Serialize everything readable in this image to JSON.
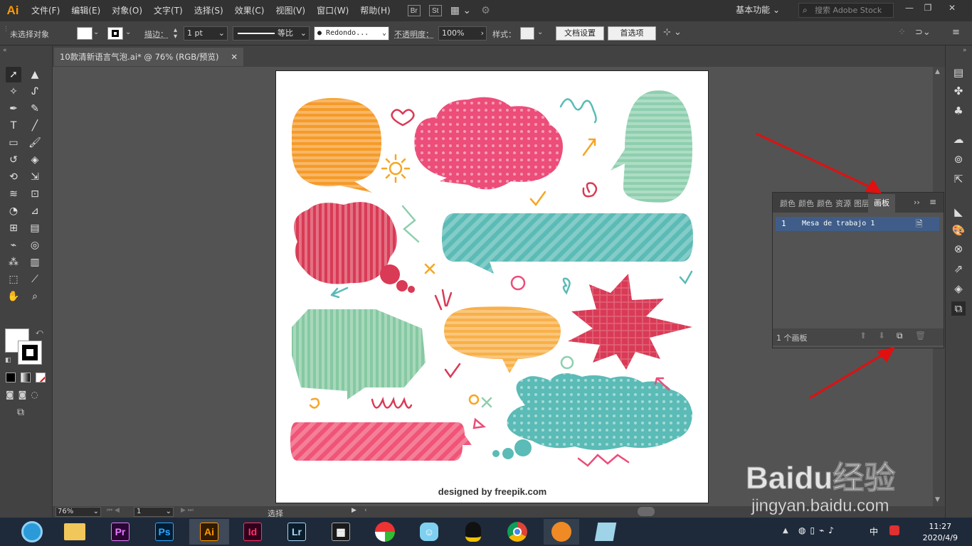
{
  "app": {
    "logo": "Ai",
    "menus": [
      "文件(F)",
      "编辑(E)",
      "对象(O)",
      "文字(T)",
      "选择(S)",
      "效果(C)",
      "视图(V)",
      "窗口(W)",
      "帮助(H)"
    ],
    "bridge": "Br",
    "stock_badge": "St",
    "workspace": "基本功能",
    "stock_placeholder": "搜索 Adobe Stock"
  },
  "control_bar": {
    "selection": "未选择对象",
    "stroke_label": "描边：",
    "stroke_value": "1 pt",
    "profile": "等比",
    "brush": "Redondo...",
    "opacity_label": "不透明度：",
    "opacity_value": "100%",
    "style_label": "样式：",
    "doc_settings": "文档设置",
    "preferences": "首选项"
  },
  "document": {
    "tab_title": "10款清新语言气泡.ai* @ 76% (RGB/预览)",
    "credit": "designed by freepik.com"
  },
  "panel": {
    "tabs": [
      "颜色",
      "颜色",
      "颜色",
      "资源",
      "图层",
      "画板"
    ],
    "active_tab": "画板",
    "artboard_number": "1",
    "artboard_name": "Mesa de trabajo 1",
    "count_text": "1 个画板"
  },
  "status": {
    "zoom": "76%",
    "page": "1",
    "mode": "选择"
  },
  "clock": {
    "time": "11:27",
    "date": "2020/4/9"
  },
  "watermark": {
    "brand": "Baidu经验",
    "url": "jingyan.baidu.com"
  },
  "taskbar_apps": [
    "Premiere",
    "Photoshop",
    "Illustrator",
    "InDesign",
    "Lightroom",
    "Film",
    "Beach",
    "Assistant",
    "QQ",
    "Chrome",
    "Fox",
    "Notes"
  ]
}
